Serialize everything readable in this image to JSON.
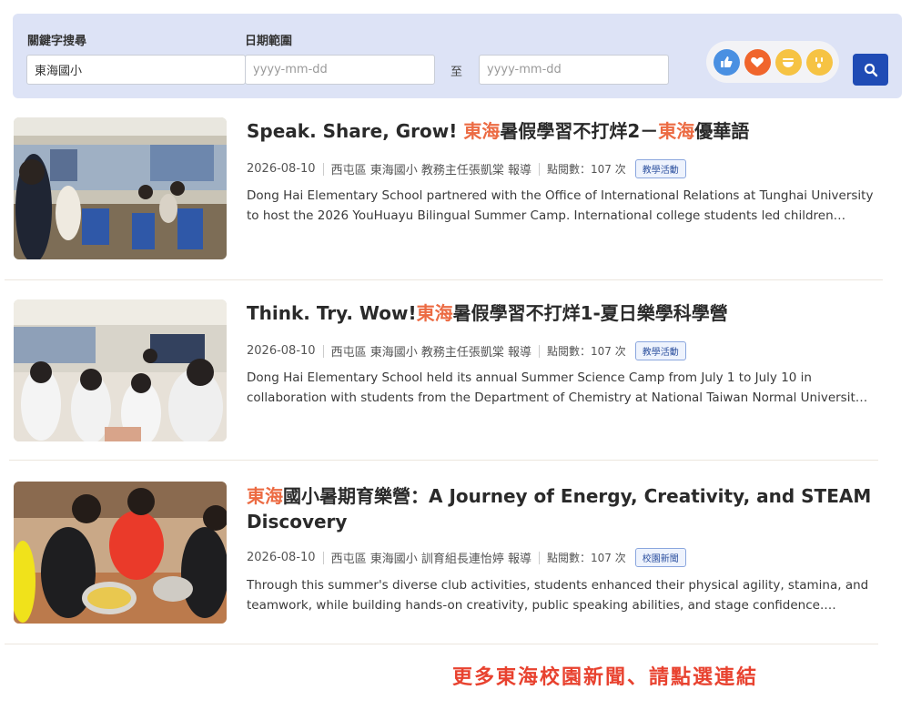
{
  "search": {
    "keyword_label": "關鍵字搜尋",
    "keyword_value": "東海國小",
    "date_label": "日期範圍",
    "date_start_placeholder": "yyyy-mm-dd",
    "date_separator": "至",
    "date_end_placeholder": "yyyy-mm-dd"
  },
  "reactions": [
    {
      "icon": "thumbs-up-icon",
      "color": "#4a90e2"
    },
    {
      "icon": "heart-icon",
      "color": "#f0652c"
    },
    {
      "icon": "smile-icon",
      "color": "#f6c343"
    },
    {
      "icon": "surprised-icon",
      "color": "#f6c343"
    }
  ],
  "colors": {
    "accent": "#1f4bb5",
    "highlight": "#ec6b43",
    "panel": "#dde3f6"
  },
  "news": [
    {
      "title_pre": "Speak. Share, Grow! ",
      "title_hl1": "東海",
      "title_mid": "暑假學習不打烊2－",
      "title_hl2": "東海",
      "title_post": "優華語",
      "date": "2026-08-10",
      "author": "西屯區 東海國小 教務主任張凱棠 報導",
      "views": "點閱數：107 次",
      "tag": "教學活動",
      "summary": "Dong Hai Elementary School partnered with the Office of International Relations at Tunghai University to host the 2026 YouHuayu Bilingual Summer Camp. International college students led children…"
    },
    {
      "title_pre": "Think. Try. Wow!",
      "title_hl1": "東海",
      "title_mid": "暑假學習不打烊1-夏日樂學科學營",
      "title_hl2": "",
      "title_post": "",
      "date": "2026-08-10",
      "author": "西屯區 東海國小 教務主任張凱棠 報導",
      "views": "點閱數：107 次",
      "tag": "教學活動",
      "summary": "Dong Hai Elementary School held its annual Summer Science Camp from July 1 to July 10 in collaboration with students from the Department of Chemistry at National Taiwan Normal Universit…"
    },
    {
      "title_pre": "",
      "title_hl1": "東海",
      "title_mid": "國小暑期育樂營：A Journey of Energy, Creativity, and STEAM Discovery",
      "title_hl2": "",
      "title_post": "",
      "date": "2026-08-10",
      "author": "西屯區 東海國小 訓育組長連怡婷 報導",
      "views": "點閱數：107 次",
      "tag": "校園新聞",
      "summary": "Through this summer's diverse club activities, students enhanced their physical agility, stamina, and teamwork, while building hands-on creativity, public speaking abilities, and stage confidence.…"
    }
  ],
  "more_link": "更多東海校園新聞、請點選連結"
}
